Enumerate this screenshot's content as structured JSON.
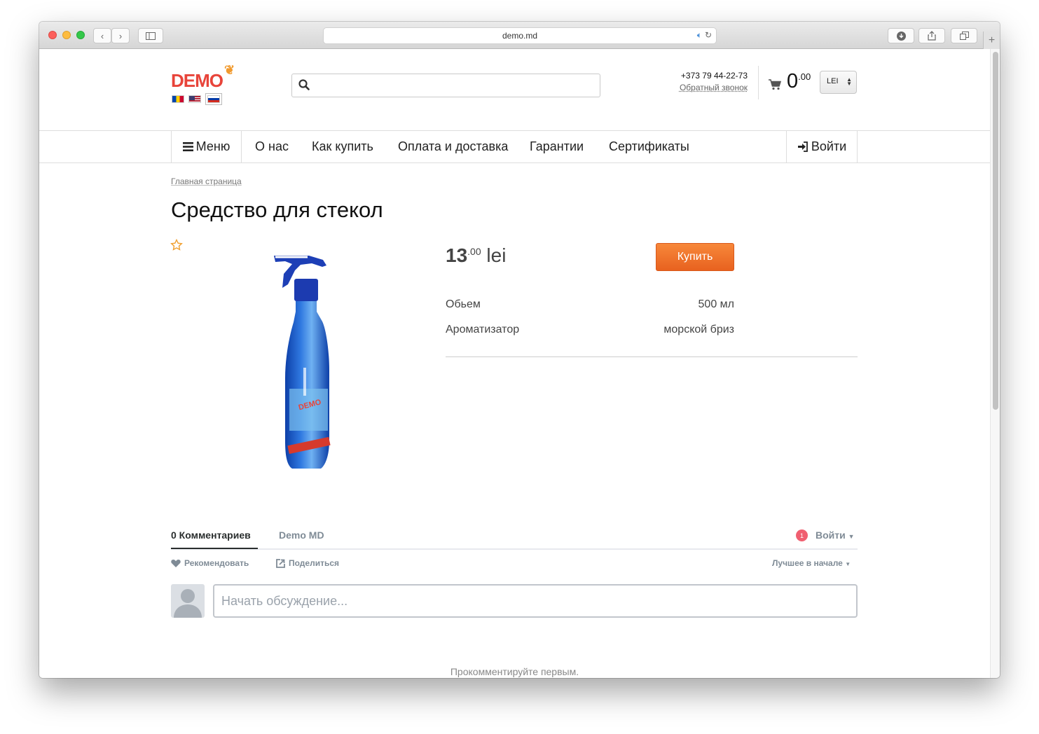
{
  "browser": {
    "url": "demo.md"
  },
  "header": {
    "logo_text": "DEMO",
    "languages": [
      "ro",
      "en",
      "ru"
    ],
    "search_placeholder": "",
    "phone": "+373 79 44-22-73",
    "callback_label": "Обратный звонок",
    "cart_total_int": "0",
    "cart_total_dec": ".00",
    "currency": "LEI"
  },
  "nav": {
    "menu_label": "Меню",
    "items": [
      "О нас",
      "Как купить",
      "Оплата и доставка",
      "Гарантии",
      "Сертификаты"
    ],
    "login_label": "Войти"
  },
  "breadcrumb": "Главная страница",
  "product": {
    "title": "Средство для стекол",
    "price_int": "13",
    "price_dec": ".00",
    "price_currency": "lei",
    "buy_label": "Купить",
    "attributes": [
      {
        "name": "Обьем",
        "value": "500 мл"
      },
      {
        "name": "Ароматизатор",
        "value": "морской бриз"
      }
    ],
    "bottle_text": "DEMO"
  },
  "comments": {
    "tab_active": "0 Комментариев",
    "tab_site": "Demo MD",
    "notification_count": "1",
    "login_label": "Войти",
    "recommend_label": "Рекомендовать",
    "share_label": "Поделиться",
    "sort_label": "Лучшее в начале",
    "input_placeholder": "Начать обсуждение...",
    "empty_label": "Прокомментируйте первым."
  },
  "colors": {
    "brand_red": "#e8443a",
    "buy_orange": "#f07a30",
    "badge_red": "#f05f70"
  }
}
